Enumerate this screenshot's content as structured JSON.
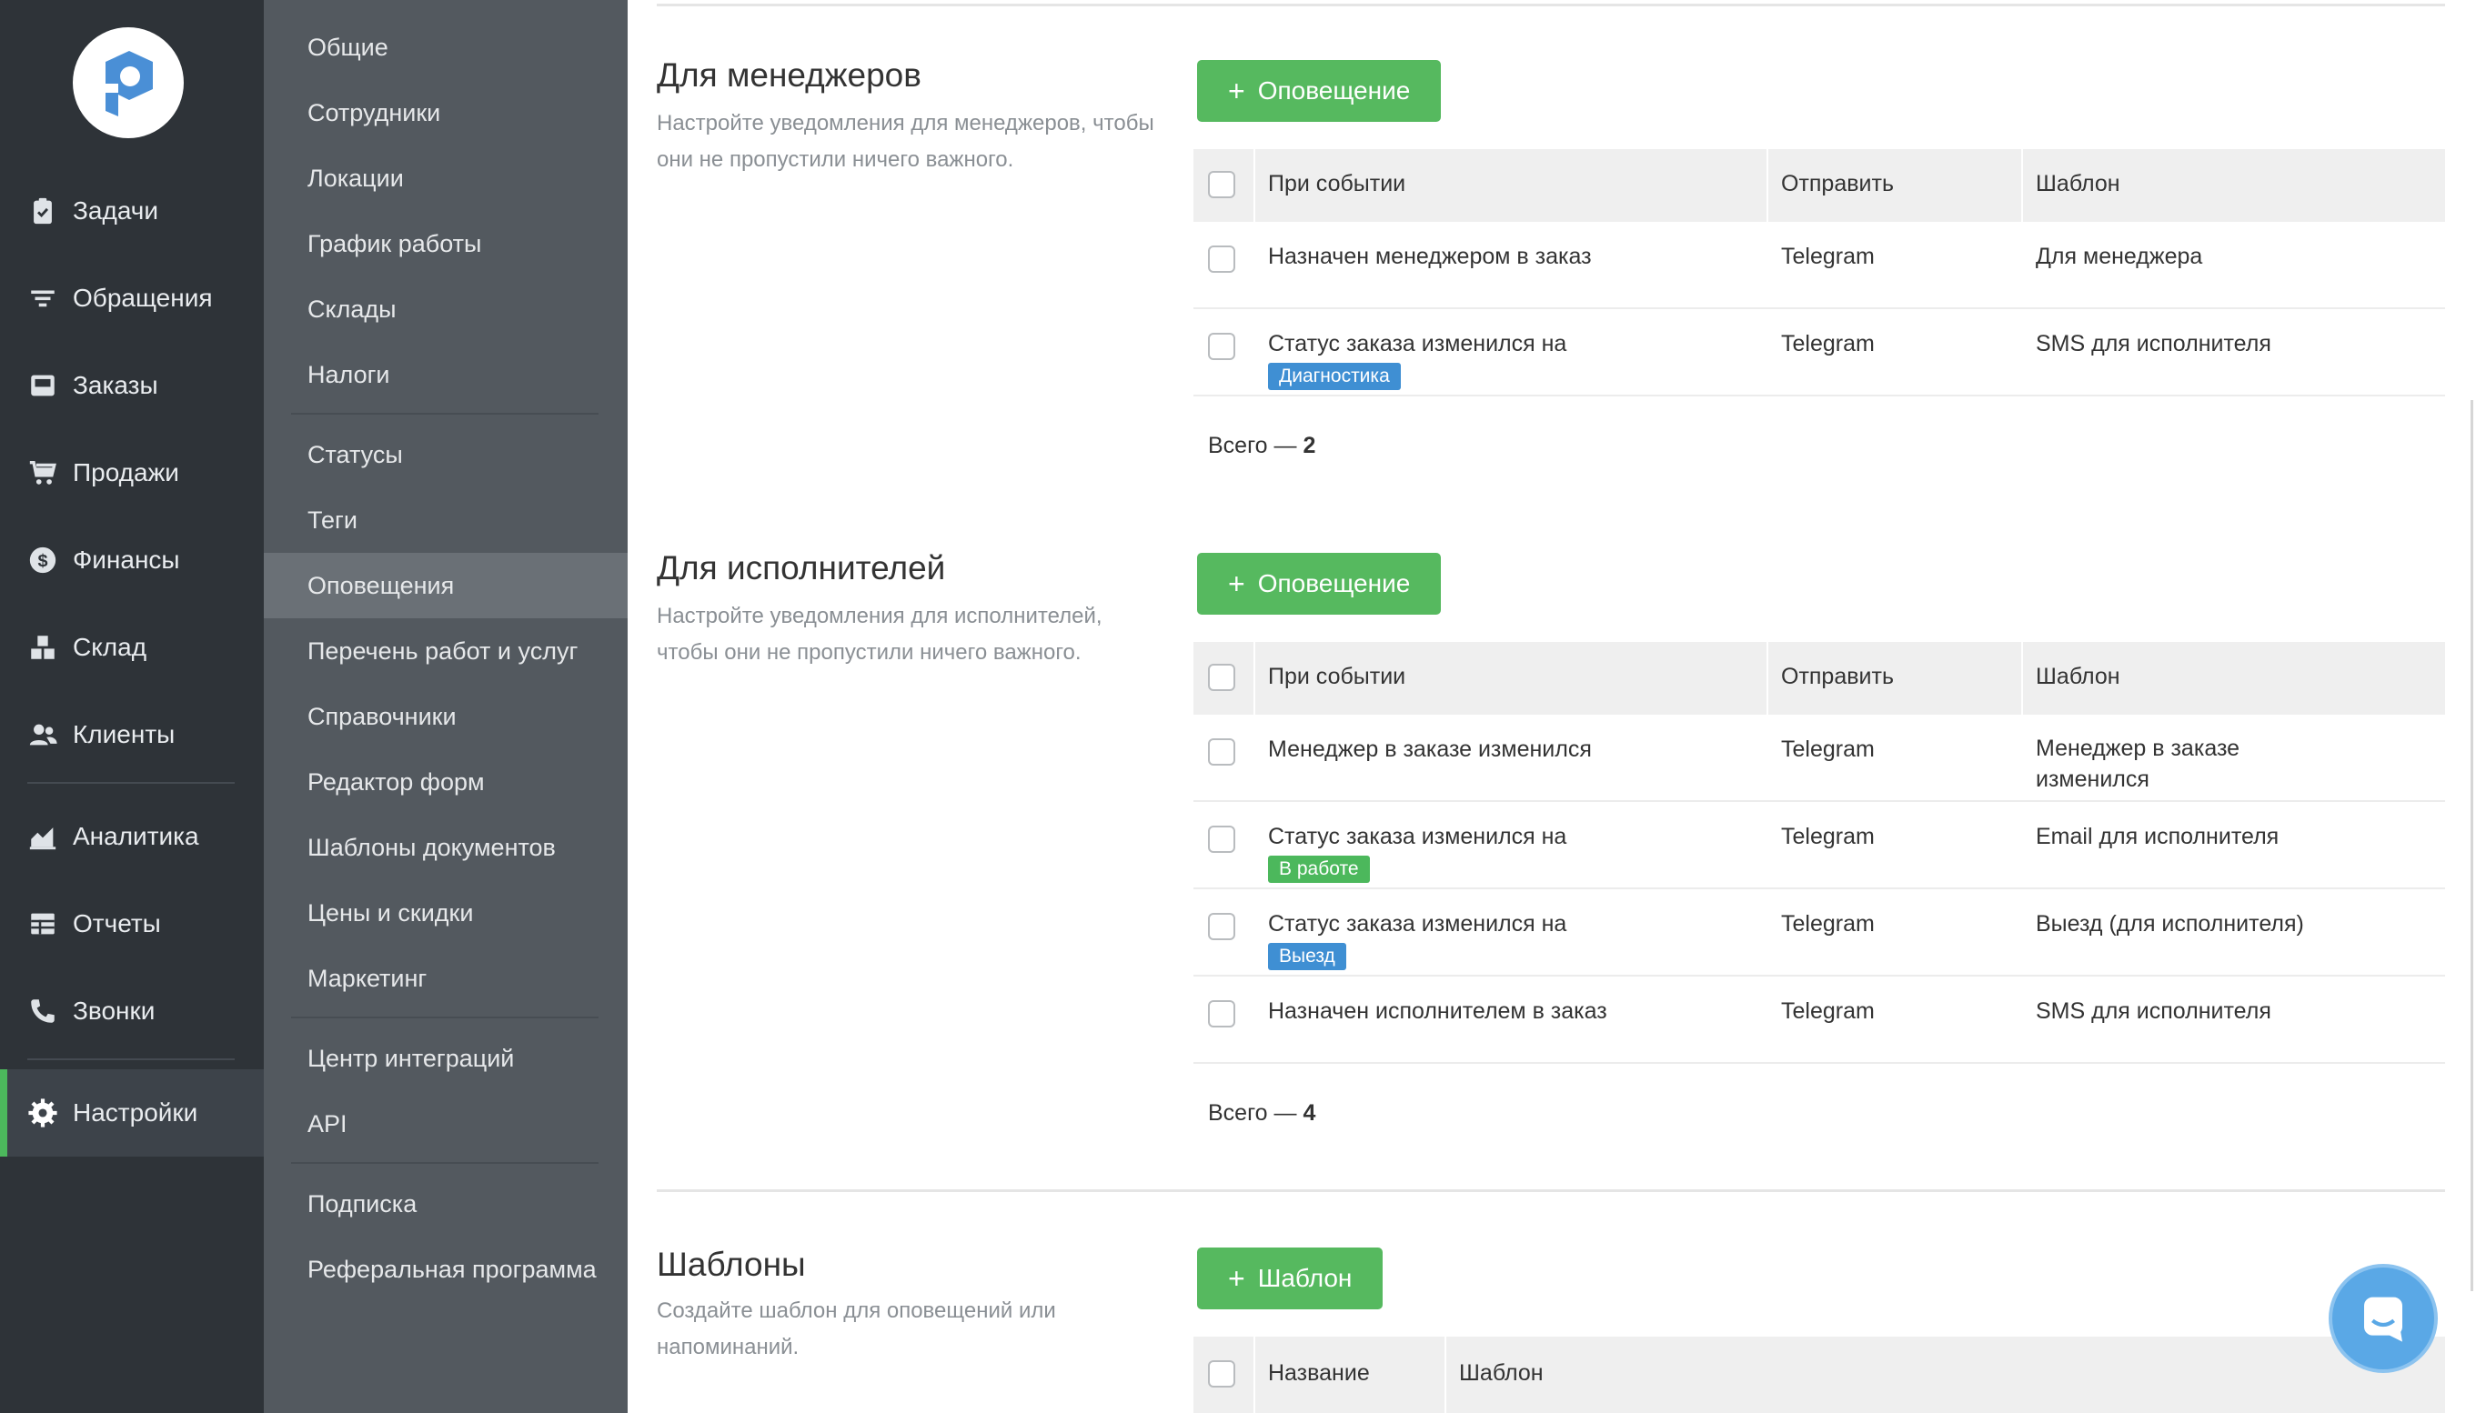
{
  "sidebar": {
    "logo": "p-logo",
    "items": [
      {
        "label": "Задачи",
        "icon": "clipboard-check-icon"
      },
      {
        "label": "Обращения",
        "icon": "filter-icon"
      },
      {
        "label": "Заказы",
        "icon": "inbox-icon"
      },
      {
        "label": "Продажи",
        "icon": "cart-icon"
      },
      {
        "label": "Финансы",
        "icon": "dollar-coin-icon"
      },
      {
        "label": "Склад",
        "icon": "boxes-icon"
      },
      {
        "label": "Клиенты",
        "icon": "users-icon"
      },
      {
        "label": "Аналитика",
        "icon": "area-chart-icon"
      },
      {
        "label": "Отчеты",
        "icon": "table-icon"
      },
      {
        "label": "Звонки",
        "icon": "phone-icon"
      },
      {
        "label": "Настройки",
        "icon": "gear-icon",
        "active": true
      }
    ]
  },
  "submenu": {
    "items": [
      "Общие",
      "Сотрудники",
      "Локации",
      "График работы",
      "Склады",
      "Налоги",
      "Статусы",
      "Теги",
      "Оповещения",
      "Перечень работ и услуг",
      "Справочники",
      "Редактор форм",
      "Шаблоны документов",
      "Цены и скидки",
      "Маркетинг",
      "Центр интеграций",
      "API",
      "Подписка",
      "Реферальная программа"
    ],
    "active": "Оповещения"
  },
  "managers": {
    "title": "Для менеджеров",
    "desc_line1": "Настройте уведомления для менеджеров, чтобы",
    "desc_line2": "они не пропустили ничего важного.",
    "button": "Оповещение",
    "headers": {
      "event": "При событии",
      "send": "Отправить",
      "template": "Шаблон"
    },
    "rows": [
      {
        "event": "Назначен менеджером в заказ",
        "badge": "",
        "send": "Telegram",
        "template": "Для менеджера"
      },
      {
        "event": "Статус заказа изменился на",
        "badge": "Диагностика",
        "badge_color": "#3f8fd3",
        "send": "Telegram",
        "template": "SMS для исполнителя"
      }
    ],
    "total_label": "Всего —",
    "total_value": "2"
  },
  "executors": {
    "title": "Для исполнителей",
    "desc_line1": "Настройте уведомления для исполнителей,",
    "desc_line2": "чтобы они не пропустили ничего важного.",
    "button": "Оповещение",
    "headers": {
      "event": "При событии",
      "send": "Отправить",
      "template": "Шаблон"
    },
    "rows": [
      {
        "event": "Менеджер в заказе изменился",
        "badge": "",
        "send": "Telegram",
        "template_line1": "Менеджер в заказе",
        "template_line2": "изменился"
      },
      {
        "event": "Статус заказа изменился на",
        "badge": "В работе",
        "badge_color": "#4cb85c",
        "send": "Telegram",
        "template_line1": "Email для исполнителя",
        "template_line2": ""
      },
      {
        "event": "Статус заказа изменился на",
        "badge": "Выезд",
        "badge_color": "#3f8fd3",
        "send": "Telegram",
        "template_line1": "Выезд (для исполнителя)",
        "template_line2": ""
      },
      {
        "event": "Назначен исполнителем в заказ",
        "badge": "",
        "send": "Telegram",
        "template_line1": "SMS для исполнителя",
        "template_line2": ""
      }
    ],
    "total_label": "Всего —",
    "total_value": "4"
  },
  "templates": {
    "title": "Шаблоны",
    "desc_line1": "Создайте шаблон для оповещений или",
    "desc_line2": "напоминаний.",
    "button": "Шаблон",
    "headers": {
      "name": "Название",
      "template": "Шаблон"
    }
  },
  "colors": {
    "accent": "#56b95f",
    "sidebar": "#2e3338",
    "submenu": "#53595f",
    "badge_blue": "#3f8fd3",
    "badge_green": "#4cb85c",
    "chat": "#5aa8e6"
  },
  "chat": {
    "icon": "chat-bubble-icon"
  }
}
